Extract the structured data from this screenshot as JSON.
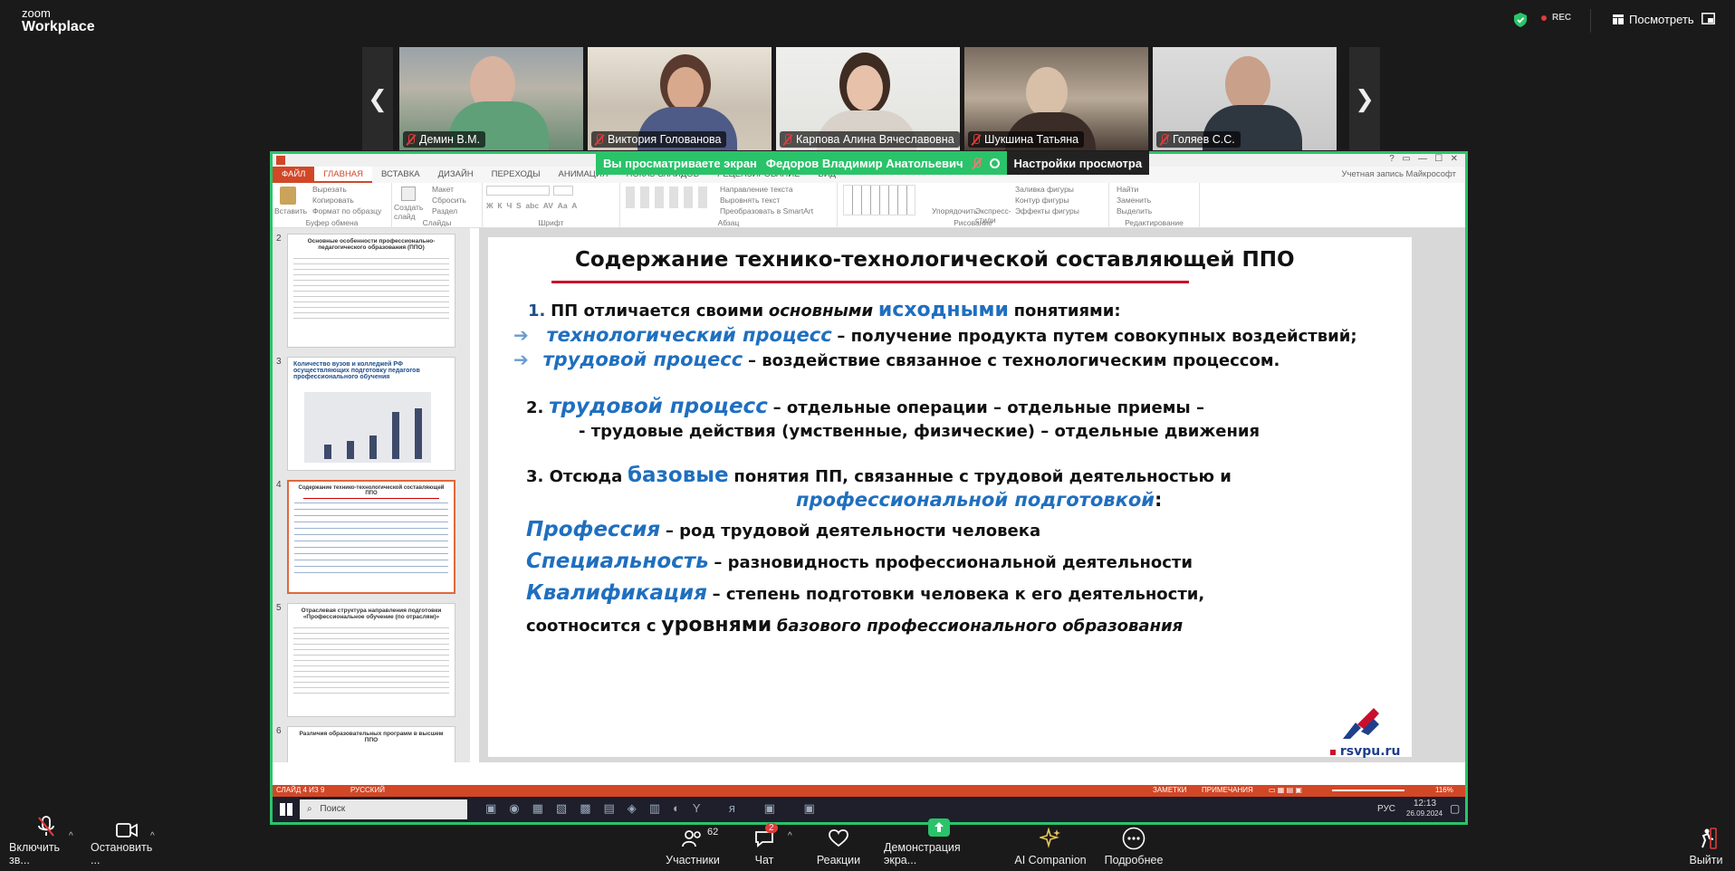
{
  "zoom": {
    "logo_line1": "zoom",
    "logo_line2": "Workplace",
    "rec": "REC",
    "view_button": "Посмотреть",
    "participants": [
      {
        "name": "Демин В.М."
      },
      {
        "name": "Виктория Голованова"
      },
      {
        "name": "Карпова Алина Вячеславовна"
      },
      {
        "name": "Шукшина Татьяна"
      },
      {
        "name": "Голяев С.С."
      }
    ],
    "banner_text": "Вы просматриваете экран",
    "banner_name": "Федоров Владимир Анатольевич",
    "banner_button": "Настройки просмотра",
    "toolbar": {
      "mic": "Включить зв...",
      "video": "Остановить ...",
      "participants": "Участники",
      "participants_count": "62",
      "chat": "Чат",
      "chat_badge": "2",
      "reactions": "Реакции",
      "share": "Демонстрация экра...",
      "ai": "AI Companion",
      "more": "Подробнее",
      "leave": "Выйти"
    }
  },
  "ppt": {
    "tabs": [
      "ФАЙЛ",
      "ГЛАВНАЯ",
      "ВСТАВКА",
      "ДИЗАЙН",
      "ПЕРЕХОДЫ",
      "АНИМАЦИЯ",
      "ПОКАЗ СЛАЙДОВ",
      "РЕЦЕНЗИРОВАНИЕ",
      "ВИД"
    ],
    "account": "Учетная запись Майкрософт",
    "ribbon": {
      "paste": "Вставить",
      "cut": "Вырезать",
      "copy": "Копировать",
      "format": "Формат по образцу",
      "clipboard": "Буфер обмена",
      "new_slide": "Создать слайд",
      "layout": "Макет",
      "reset": "Сбросить",
      "section": "Раздел",
      "slides": "Слайды",
      "font": "Шрифт",
      "text_dir": "Направление текста",
      "align_text": "Выровнять текст",
      "smartart": "Преобразовать в SmartArt",
      "paragraph": "Абзац",
      "arrange": "Упорядочить",
      "quick_styles": "Экспресс-стили",
      "fill": "Заливка фигуры",
      "outline": "Контур фигуры",
      "effects": "Эффекты фигуры",
      "drawing": "Рисование",
      "find": "Найти",
      "replace": "Заменить",
      "select": "Выделить",
      "editing": "Редактирование"
    },
    "thumbs": [
      {
        "num": "2",
        "title": "Основные особенности профессионально-педагогического образования (ППО)"
      },
      {
        "num": "3",
        "title": "Количество вузов и колледжей РФ осуществляющих подготовку педагогов профессионального обучения"
      },
      {
        "num": "4",
        "title": "Содержание технико-технологической составляющей ППО"
      },
      {
        "num": "5",
        "title": "Отраслевая структура направления подготовки «Профессиональное обучение (по отраслям)»"
      },
      {
        "num": "6",
        "title": "Различия образовательных программ в высшем ППО"
      }
    ],
    "slide": {
      "title": "Содержание технико-технологической составляющей ППО",
      "l1_num": "1.",
      "l1_a": "ПП отличается своими",
      "l1_b": "основными",
      "l1_c": "исходными",
      "l1_d": "понятиями:",
      "l2_term": "технологический процесс",
      "l2_rest": "– получение продукта путем совокупных воздействий;",
      "l3_term": "трудовой процесс",
      "l3_rest": "– воздействие связанное с технологическим процессом.",
      "l4_num": "2.",
      "l4_term": "трудовой процесс",
      "l4_rest": "– отдельные операции – отдельные приемы –",
      "l5": "- трудовые действия (умственные, физические) – отдельные движения",
      "l6_a": "3. Отсюда",
      "l6_b": "базовые",
      "l6_c": "понятия ПП, связанные с трудовой деятельностью и",
      "l7_term": "профессиональной подготовкой",
      "l7_colon": ":",
      "l8_term": "Профессия",
      "l8_rest": "– род трудовой деятельности человека",
      "l9_term": "Специальность",
      "l9_rest": "– разновидность профессиональной деятельности",
      "l10_term": "Квалификация",
      "l10_rest": "– степень подготовки человека к его деятельности,",
      "l11_a": "соотносится с",
      "l11_b": "уровнями",
      "l11_c": "базового профессионального образования",
      "site": "rsvpu.ru"
    },
    "status": {
      "slide": "СЛАЙД 4 ИЗ 9",
      "lang": "РУССКИЙ",
      "notes": "ЗАМЕТКИ",
      "comments": "ПРИМЕЧАНИЯ",
      "zoom": "116%"
    },
    "taskbar": {
      "search": "Поиск",
      "lang": "РУС",
      "time": "12:13",
      "date": "26.09.2024"
    }
  }
}
